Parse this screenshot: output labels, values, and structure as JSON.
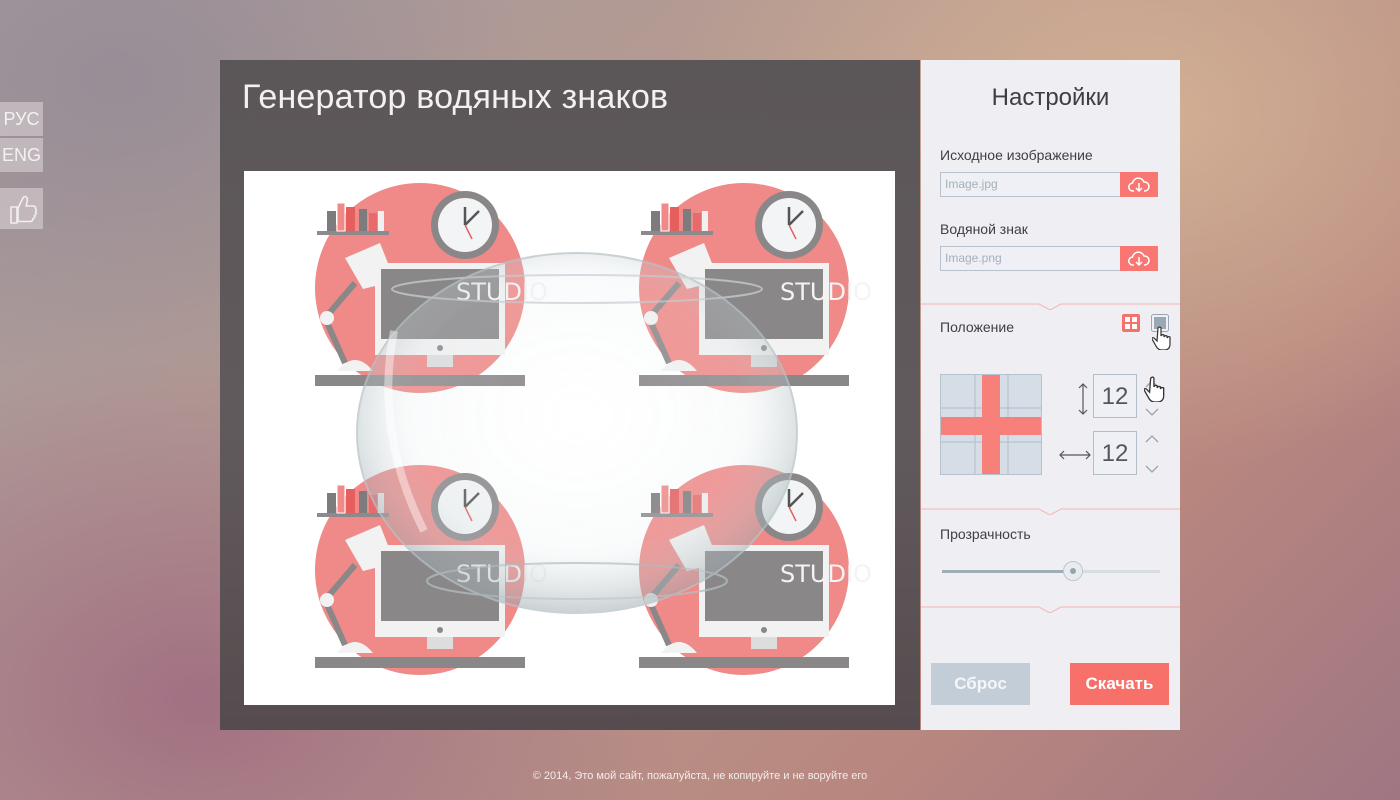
{
  "language": {
    "ru": "РУС",
    "en": "ENG"
  },
  "app": {
    "title": "Генератор водяных знаков"
  },
  "preview": {
    "watermark_text": "STUDIO"
  },
  "settings": {
    "title": "Настройки",
    "source_label": "Исходное изображение",
    "source_file": "Image.jpg",
    "watermark_label": "Водяной знак",
    "watermark_file": "Image.png",
    "position_label": "Положение",
    "vertical_gap": "12",
    "horizontal_gap": "12",
    "opacity_label": "Прозрачность",
    "opacity_value": 0.6,
    "reset_label": "Сброс",
    "download_label": "Скачать"
  },
  "colors": {
    "accent": "#f7716a",
    "muted_button": "#c3cdd7",
    "panel_dark": "#5b5658",
    "settings_bg": "#eeeef3"
  },
  "footer": {
    "text": "© 2014, Это мой сайт, пожалуйста, не копируйте и не воруйте его"
  }
}
